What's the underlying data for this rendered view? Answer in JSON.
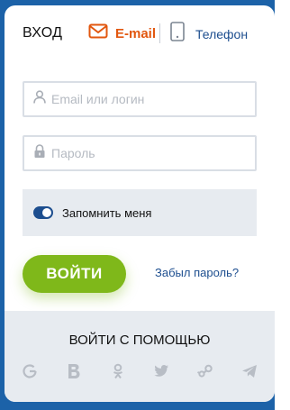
{
  "header": {
    "title": "ВХОД"
  },
  "tabs": [
    {
      "label": "E-mail",
      "icon": "mail-icon",
      "active": true,
      "color": "#e2570f"
    },
    {
      "label": "Телефон",
      "icon": "phone-icon",
      "active": false,
      "color": "#1d4e8f"
    }
  ],
  "form": {
    "login_placeholder": "Email или логин",
    "password_placeholder": "Пароль",
    "remember_label": "Запомнить меня",
    "remember_checked": true,
    "submit_label": "ВОЙТИ",
    "forgot_label": "Забыл пароль?"
  },
  "social": {
    "title": "ВОЙТИ С ПОМОЩЬЮ",
    "providers": [
      "google-icon",
      "vk-icon",
      "odnoklassniki-icon",
      "twitter-icon",
      "steam-icon",
      "telegram-icon"
    ]
  },
  "colors": {
    "background": "#1c62a8",
    "accent_orange": "#e2570f",
    "link_blue": "#1d4e8f",
    "button_green": "#7fb81a",
    "panel_gray": "#e7ebf0"
  }
}
